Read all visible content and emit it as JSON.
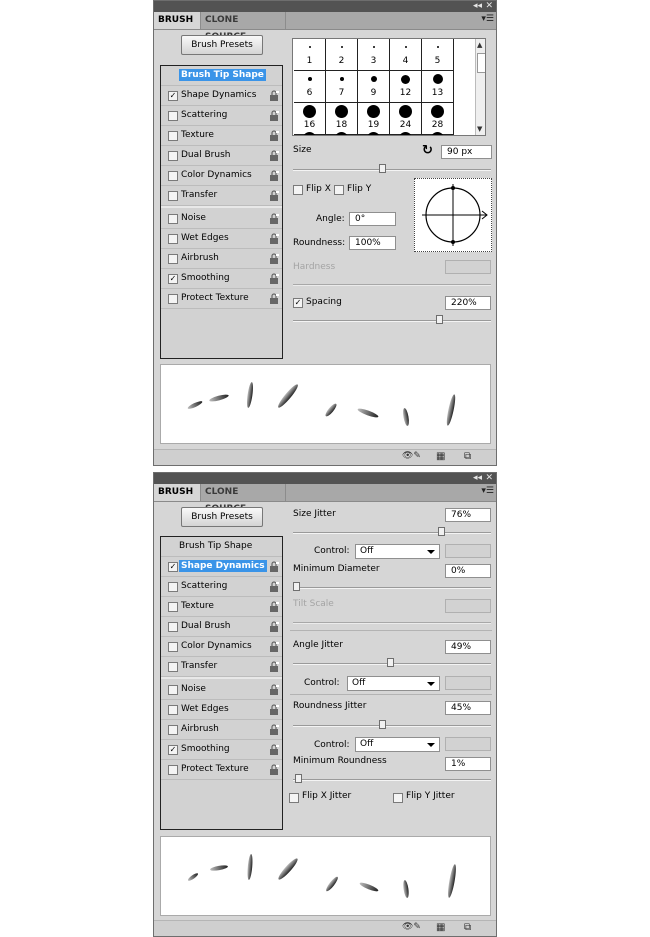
{
  "panel1": {
    "tabs": [
      "BRUSH",
      "CLONE SOURCE"
    ],
    "presets_button": "Brush Presets",
    "list": [
      {
        "label": "Brush Tip Shape",
        "checked": null,
        "selected": true
      },
      {
        "label": "Shape Dynamics",
        "checked": true,
        "selected": false
      },
      {
        "label": "Scattering",
        "checked": false,
        "selected": false
      },
      {
        "label": "Texture",
        "checked": false,
        "selected": false
      },
      {
        "label": "Dual Brush",
        "checked": false,
        "selected": false
      },
      {
        "label": "Color Dynamics",
        "checked": false,
        "selected": false
      },
      {
        "label": "Transfer",
        "checked": false,
        "selected": false
      },
      {
        "label": "Noise",
        "checked": false,
        "selected": false
      },
      {
        "label": "Wet Edges",
        "checked": false,
        "selected": false
      },
      {
        "label": "Airbrush",
        "checked": false,
        "selected": false
      },
      {
        "label": "Smoothing",
        "checked": true,
        "selected": false
      },
      {
        "label": "Protect Texture",
        "checked": false,
        "selected": false
      }
    ],
    "tips": [
      "1",
      "2",
      "3",
      "4",
      "5",
      "6",
      "7",
      "9",
      "12",
      "13",
      "16",
      "18",
      "19",
      "24",
      "28"
    ],
    "size_label": "Size",
    "size_value": "90 px",
    "size_slider": 0.45,
    "flip_x_label": "Flip X",
    "flip_y_label": "Flip Y",
    "angle_label": "Angle:",
    "angle_value": "0°",
    "roundness_label": "Roundness:",
    "roundness_value": "100%",
    "hardness_label": "Hardness",
    "spacing_label": "Spacing",
    "spacing_value": "220%",
    "spacing_slider": 0.75,
    "spacing_checked": true
  },
  "panel2": {
    "tabs": [
      "BRUSH",
      "CLONE SOURCE"
    ],
    "presets_button": "Brush Presets",
    "list": [
      {
        "label": "Brush Tip Shape",
        "checked": null,
        "selected": false
      },
      {
        "label": "Shape Dynamics",
        "checked": true,
        "selected": true
      },
      {
        "label": "Scattering",
        "checked": false,
        "selected": false
      },
      {
        "label": "Texture",
        "checked": false,
        "selected": false
      },
      {
        "label": "Dual Brush",
        "checked": false,
        "selected": false
      },
      {
        "label": "Color Dynamics",
        "checked": false,
        "selected": false
      },
      {
        "label": "Transfer",
        "checked": false,
        "selected": false
      },
      {
        "label": "Noise",
        "checked": false,
        "selected": false
      },
      {
        "label": "Wet Edges",
        "checked": false,
        "selected": false
      },
      {
        "label": "Airbrush",
        "checked": false,
        "selected": false
      },
      {
        "label": "Smoothing",
        "checked": true,
        "selected": false
      },
      {
        "label": "Protect Texture",
        "checked": false,
        "selected": false
      }
    ],
    "size_jitter_label": "Size Jitter",
    "size_jitter_value": "76%",
    "size_jitter_slider": 0.76,
    "control_label": "Control:",
    "control_value": "Off",
    "min_diameter_label": "Minimum Diameter",
    "min_diameter_value": "0%",
    "min_diameter_slider": 0.0,
    "tilt_scale_label": "Tilt Scale",
    "angle_jitter_label": "Angle Jitter",
    "angle_jitter_value": "49%",
    "angle_jitter_slider": 0.49,
    "roundness_jitter_label": "Roundness Jitter",
    "roundness_jitter_value": "45%",
    "roundness_jitter_slider": 0.45,
    "min_roundness_label": "Minimum Roundness",
    "min_roundness_value": "1%",
    "min_roundness_slider": 0.01,
    "flip_x_jitter_label": "Flip X Jitter",
    "flip_y_jitter_label": "Flip Y Jitter"
  }
}
